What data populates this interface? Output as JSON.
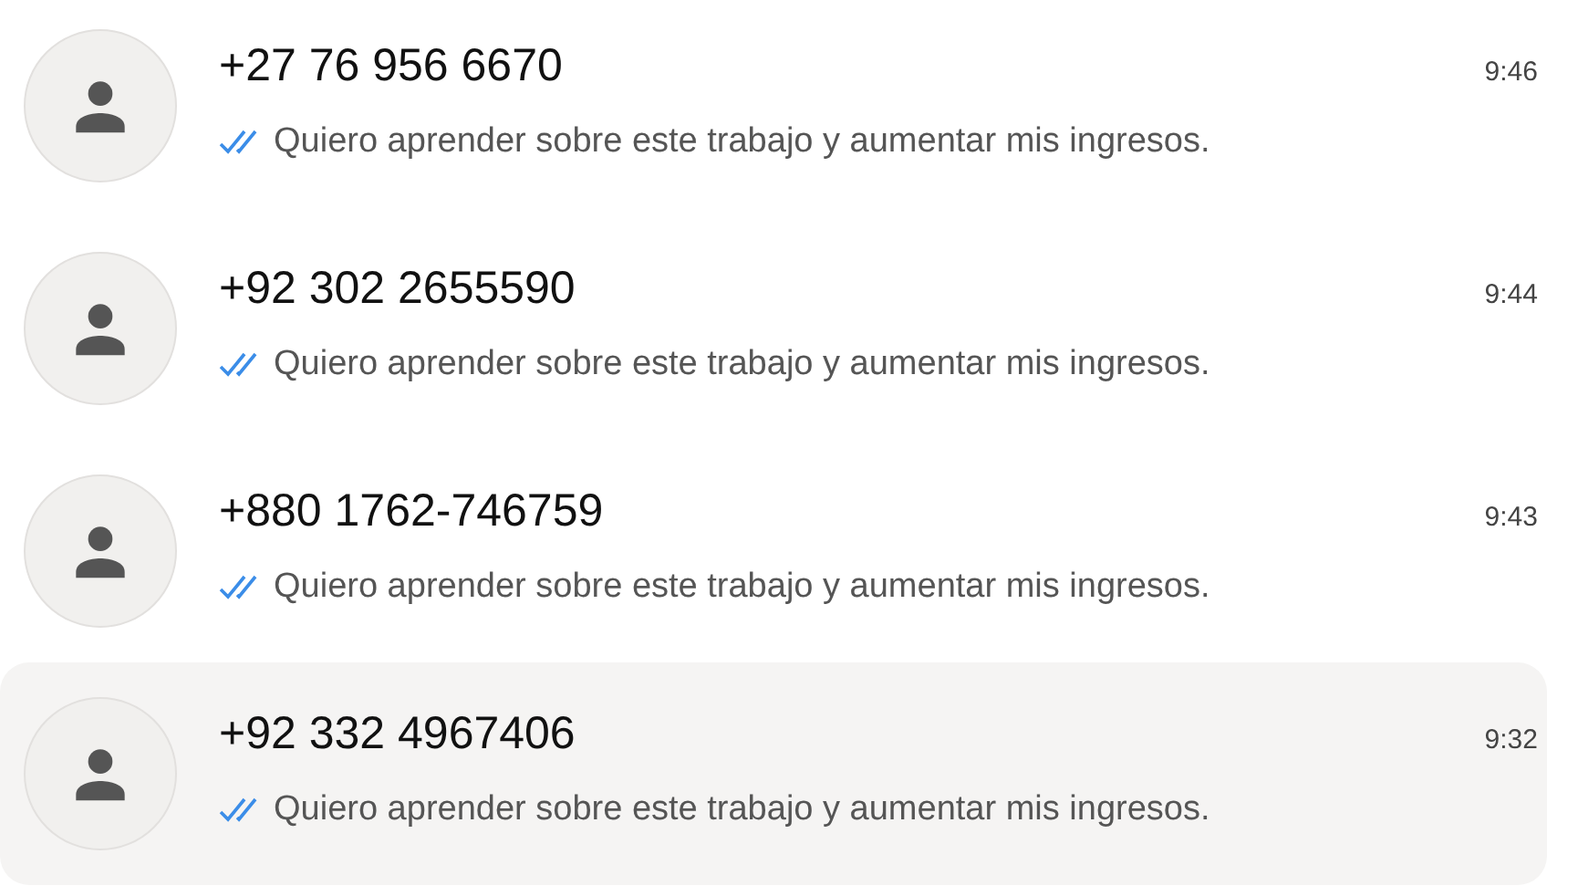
{
  "chats": [
    {
      "name": "+27 76 956 6670",
      "message": "Quiero aprender sobre este trabajo y aumentar mis ingresos.",
      "time": "9:46",
      "read": true,
      "selected": false
    },
    {
      "name": "+92 302 2655590",
      "message": "Quiero aprender sobre este trabajo y aumentar mis ingresos.",
      "time": "9:44",
      "read": true,
      "selected": false
    },
    {
      "name": "+880 1762-746759",
      "message": "Quiero aprender sobre este trabajo y aumentar mis ingresos.",
      "time": "9:43",
      "read": true,
      "selected": false
    },
    {
      "name": "+92 332 4967406",
      "message": "Quiero aprender sobre este trabajo y aumentar mis ingresos.",
      "time": "9:32",
      "read": true,
      "selected": true
    }
  ]
}
